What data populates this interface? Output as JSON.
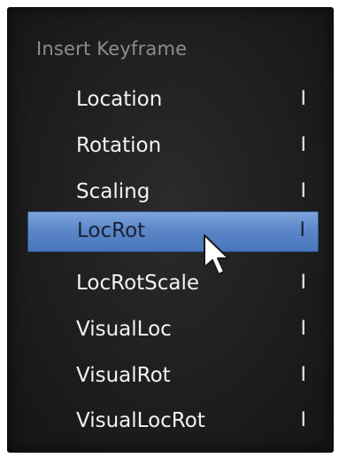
{
  "menu": {
    "title": "Insert Keyframe",
    "items": [
      {
        "label": "Location",
        "shortcut": "I"
      },
      {
        "label": "Rotation",
        "shortcut": "I"
      },
      {
        "label": "Scaling",
        "shortcut": "I"
      },
      {
        "label": "LocRot",
        "shortcut": "I",
        "highlighted": true
      },
      {
        "label": "LocRotScale",
        "shortcut": "I"
      },
      {
        "label": "VisualLoc",
        "shortcut": "I"
      },
      {
        "label": "VisualRot",
        "shortcut": "I"
      },
      {
        "label": "VisualLocRot",
        "shortcut": "I"
      }
    ]
  },
  "colors": {
    "menu_background": "#222222",
    "highlight": "#5b86c8",
    "title_text": "#8d8d8d",
    "item_text": "#f2f2f2"
  },
  "icons": {
    "cursor": "mouse-pointer-arrow-icon"
  }
}
